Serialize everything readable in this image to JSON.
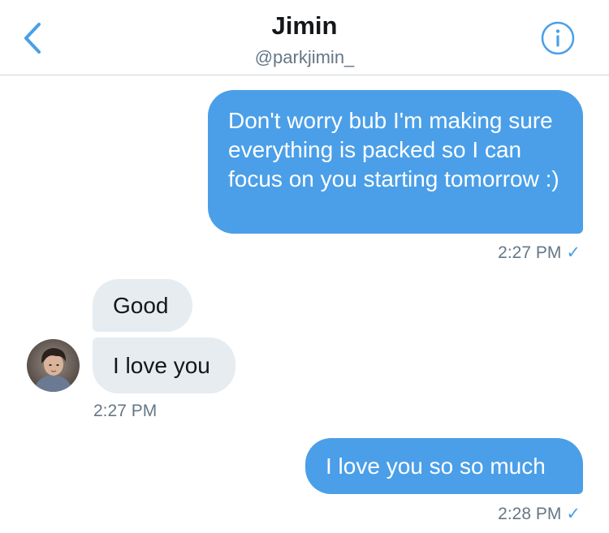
{
  "header": {
    "name": "Jimin",
    "handle": "@parkjimin_",
    "back_icon": "chevron-left-icon",
    "info_icon": "info-icon"
  },
  "messages": [
    {
      "direction": "sent",
      "text": "Don't worry bub I'm making sure everything is packed so I can focus on you starting tomorrow :)"
    },
    {
      "direction": "received",
      "text": "Good"
    },
    {
      "direction": "received",
      "text": "I love you"
    },
    {
      "direction": "sent",
      "text": "I love you so so much"
    }
  ],
  "timestamps": {
    "first_sent": "2:27 PM",
    "received_group": "2:27 PM",
    "last_sent": "2:28 PM",
    "read_mark": "✓"
  },
  "colors": {
    "accent": "#4a9fe8",
    "received_bubble": "#e6ecf0",
    "secondary_text": "#657786"
  }
}
